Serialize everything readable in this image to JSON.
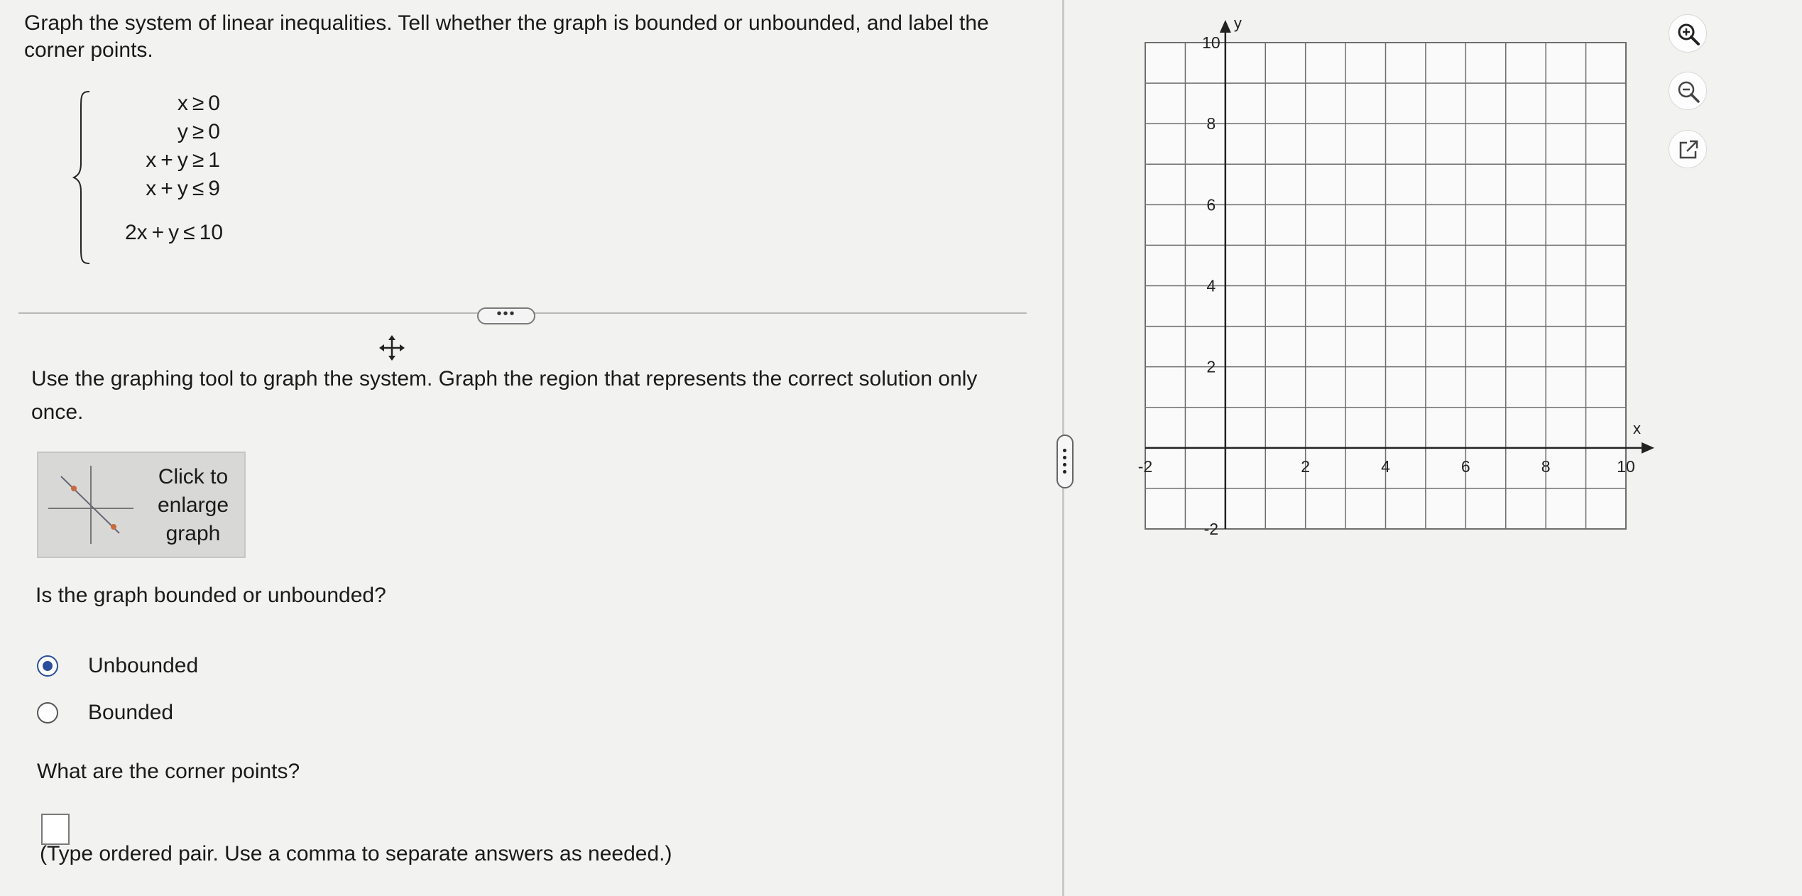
{
  "prompt": "Graph the system of linear inequalities. Tell whether the graph is bounded or unbounded, and label the corner points.",
  "system": {
    "inequalities": [
      "x ≥ 0",
      "y ≥ 0",
      "x + y ≥ 1",
      "x + y ≤ 9",
      "2x + y ≤ 10"
    ]
  },
  "more_button": "•••",
  "instructions": "Use the graphing tool to graph the system. Graph the region that represents the correct solution only once.",
  "enlarge_button": {
    "label": "Click to enlarge graph"
  },
  "question": "Is the graph bounded or unbounded?",
  "options": [
    {
      "label": "Unbounded",
      "selected": true
    },
    {
      "label": "Bounded",
      "selected": false
    }
  ],
  "corner_question": "What are the corner points?",
  "answer": {
    "value": ""
  },
  "hint": "(Type ordered pair. Use a comma to separate answers as needed.)",
  "graph": {
    "x_label": "x",
    "y_label": "y",
    "x_range": [
      -2,
      10
    ],
    "y_range": [
      -2,
      10
    ],
    "x_ticks": [
      {
        "value": -2,
        "label": "-2"
      },
      {
        "value": 2,
        "label": "2"
      },
      {
        "value": 4,
        "label": "4"
      },
      {
        "value": 6,
        "label": "6"
      },
      {
        "value": 8,
        "label": "8"
      },
      {
        "value": 10,
        "label": "10"
      }
    ],
    "y_ticks": [
      {
        "value": 10,
        "label": "10"
      },
      {
        "value": 8,
        "label": "8"
      },
      {
        "value": 6,
        "label": "6"
      },
      {
        "value": 4,
        "label": "4"
      },
      {
        "value": 2,
        "label": "2"
      },
      {
        "value": -2,
        "label": "-2"
      }
    ],
    "grid": true
  },
  "tools": [
    "zoom-in-icon",
    "zoom-out-icon",
    "pop-out-icon"
  ],
  "colors": {
    "accent": "#2b4f9a",
    "grid": "#6e6e6e",
    "background": "#f2f2f0"
  }
}
